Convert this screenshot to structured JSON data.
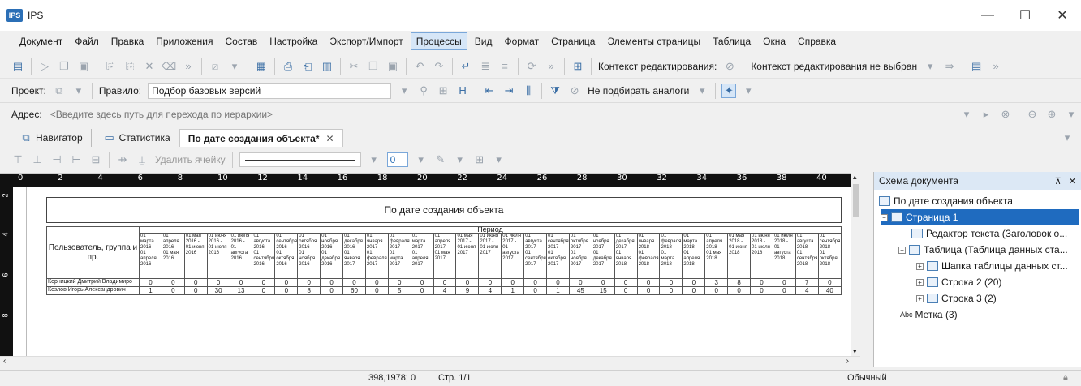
{
  "window": {
    "title": "IPS",
    "logo": "IPS",
    "minimize": "—",
    "maximize": "☐",
    "close": "✕"
  },
  "menu": [
    "Документ",
    "Файл",
    "Правка",
    "Приложения",
    "Состав",
    "Настройка",
    "Экспорт/Импорт",
    "Процессы",
    "Вид",
    "Формат",
    "Страница",
    "Элементы страницы",
    "Таблица",
    "Окна",
    "Справка"
  ],
  "toolbar1": {
    "context_label": "Контекст редактирования:",
    "context_value": "Контекст редактирования не выбран"
  },
  "toolbar2": {
    "project_label": "Проект:",
    "rule_label": "Правило:",
    "rule_value": "Подбор базовых версий",
    "analog_label": "Не подбирать аналоги"
  },
  "address": {
    "label": "Адрес:",
    "placeholder": "<Введите здесь путь для перехода по иерархии>"
  },
  "tabs": [
    {
      "label": "Навигатор"
    },
    {
      "label": "Статистика"
    },
    {
      "label": "По дате создания объекта*"
    }
  ],
  "doc_toolbar": {
    "delete_cell": "Удалить ячейку",
    "width_value": "0"
  },
  "ruler": {
    "h_numbers": [
      "0",
      "2",
      "4",
      "6",
      "8",
      "10",
      "12",
      "14",
      "16",
      "18",
      "20",
      "22",
      "24",
      "26",
      "28",
      "30",
      "32",
      "34",
      "36",
      "38",
      "40"
    ]
  },
  "document": {
    "title": "По дате создания объекта",
    "user_header": "Пользователь, группа и пр.",
    "period_header": "Период",
    "period_columns": [
      "01 марта 2016 - 01 апреля 2016",
      "01 апреля 2016 - 01 мая 2016",
      "01 мая 2016 - 01 июня 2016",
      "01 июня 2016 - 01 июля 2016",
      "01 июля 2016 - 01 августа 2016",
      "01 августа 2016 - 01 сентября 2016",
      "01 сентября 2016 - 01 октября 2016",
      "01 октября 2016 - 01 ноября 2016",
      "01 ноября 2016 - 01 декабря 2016",
      "01 декабря 2016 - 01 января 2017",
      "01 января 2017 - 01 февраля 2017",
      "01 февраля 2017 - 01 марта 2017",
      "01 марта 2017 - 01 апреля 2017",
      "01 апреля 2017 - 01 мая 2017",
      "01 мая 2017 - 01 июня 2017",
      "01 июня 2017 - 01 июля 2017",
      "01 июля 2017 - 01 августа 2017",
      "01 августа 2017 - 01 сентября 2017",
      "01 сентября 2017 - 01 октября 2017",
      "01 октября 2017 - 01 ноября 2017",
      "01 ноября 2017 - 01 декабря 2017",
      "01 декабря 2017 - 01 января 2018",
      "01 января 2018 - 01 февраля 2018",
      "01 февраля 2018 - 01 марта 2018",
      "01 марта 2018 - 01 апреля 2018",
      "01 апреля 2018 - 01 мая 2018",
      "01 мая 2018 - 01 июня 2018",
      "01 июня 2018 - 01 июля 2018",
      "01 июля 2018 - 01 августа 2018",
      "01 августа 2018 - 01 сентября 2018",
      "01 сентября 2018 - 01 октября 2018"
    ],
    "rows": [
      {
        "name": "Корницкий Дмитрий Владимиро",
        "values": [
          "0",
          "0",
          "0",
          "0",
          "0",
          "0",
          "0",
          "0",
          "0",
          "0",
          "0",
          "0",
          "0",
          "0",
          "0",
          "0",
          "0",
          "0",
          "0",
          "0",
          "0",
          "0",
          "0",
          "0",
          "0",
          "3",
          "8",
          "0",
          "0",
          "7",
          "0",
          "6"
        ]
      },
      {
        "name": "Козлов Игорь Александрович",
        "values": [
          "1",
          "0",
          "0",
          "30",
          "13",
          "0",
          "0",
          "8",
          "0",
          "60",
          "0",
          "5",
          "0",
          "4",
          "9",
          "4",
          "1",
          "0",
          "1",
          "45",
          "15",
          "0",
          "0",
          "0",
          "0",
          "0",
          "0",
          "0",
          "0",
          "4",
          "40",
          "2"
        ]
      }
    ]
  },
  "outline": {
    "title": "Схема документа",
    "pin": "⊼",
    "close": "✕",
    "items": [
      {
        "label": "По дате создания объекта"
      },
      {
        "label": "Страница 1"
      },
      {
        "label": "Редактор текста (Заголовок о..."
      },
      {
        "label": "Таблица (Таблица данных ста..."
      },
      {
        "label": "Шапка таблицы данных ст..."
      },
      {
        "label": "Строка 2 (20)"
      },
      {
        "label": "Строка 3 (2)"
      },
      {
        "label": "Метка (3)"
      }
    ]
  },
  "status": {
    "coords": "398,1978; 0",
    "page": "Стр. 1/1",
    "mode": "Обычный"
  }
}
